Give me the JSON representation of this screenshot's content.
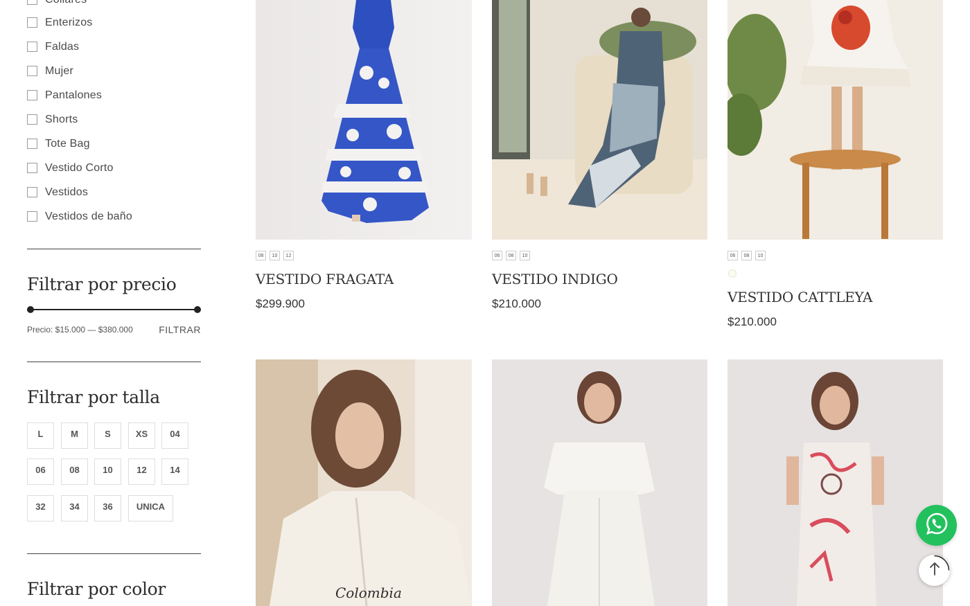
{
  "categories": [
    "Collares",
    "Enterizos",
    "Faldas",
    "Mujer",
    "Pantalones",
    "Shorts",
    "Tote Bag",
    "Vestido Corto",
    "Vestidos",
    "Vestidos de baño"
  ],
  "price_filter": {
    "title": "Filtrar por precio",
    "price_label": "Precio: $15.000 — $380.000",
    "button": "FILTRAR"
  },
  "size_filter": {
    "title": "Filtrar por talla",
    "sizes": [
      "L",
      "M",
      "S",
      "XS",
      "04",
      "06",
      "08",
      "10",
      "12",
      "14",
      "32",
      "34",
      "36",
      "UNICA"
    ]
  },
  "color_filter": {
    "title": "Filtrar por color"
  },
  "products": [
    {
      "name": "VESTIDO FRAGATA",
      "price": "$299.900",
      "sizes": [
        "08",
        "10",
        "12"
      ]
    },
    {
      "name": "VESTIDO INDIGO",
      "price": "$210.000",
      "sizes": [
        "06",
        "08",
        "10"
      ]
    },
    {
      "name": "VESTIDO CATTLEYA",
      "price": "$210.000",
      "sizes": [
        "06",
        "08",
        "10"
      ],
      "color_swatch": "#fbfbf2"
    }
  ],
  "second_row_products": [
    {
      "image_caption": "Colombia"
    },
    {},
    {}
  ],
  "icons": {
    "whatsapp": "whatsapp-icon",
    "scroll_top": "arrow-up-icon"
  },
  "colors": {
    "whatsapp": "#22c15e",
    "text": "#333333"
  }
}
